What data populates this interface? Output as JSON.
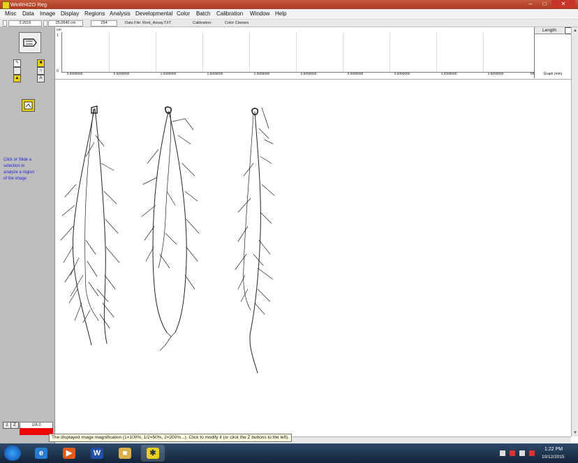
{
  "window": {
    "title": "WinRHIZO Reg"
  },
  "menu": [
    "Misc",
    "Data",
    "Image",
    "Display",
    "Regions",
    "Analysis",
    "Developmental",
    "Color",
    "Batch",
    "Calibration",
    "Window",
    "Help"
  ],
  "infobar": {
    "field1": "2.2016",
    "field2": "25.0640 cm",
    "field3": "254",
    "data_file": "Data File: Root_Assay.TXT",
    "calibration": "Calibration:",
    "color_classes": "Color Classes"
  },
  "graph": {
    "unit": "cm",
    "y_top": "1",
    "y_bottom": "0",
    "x_ticks": [
      "0.0000000",
      "0.5000000",
      "1.0000000",
      "1.5000000",
      "2.0000000",
      "2.5000000",
      "3.0000000",
      "3.5000000",
      "4.0000000",
      "4.5000000"
    ],
    "inf_label": "Inf",
    "length_header": "Length",
    "graph_label": "Graph (mm)"
  },
  "left_panel": {
    "hint": "Click or Slide a selection to analyze a region of the image",
    "magnification": "1/8.0"
  },
  "status_tip": "The displayed image magnification (1=100%, 1/2=50%, 2=200%...). Click to modify it (or click the Z buttons to the left).",
  "clock": {
    "time": "1:22 PM",
    "date": "10/12/2015"
  },
  "colors": {
    "titlebar": "#b8462e",
    "redbar": "#f00000",
    "hint": "#2424d8",
    "taskbar": "#1c3450"
  }
}
